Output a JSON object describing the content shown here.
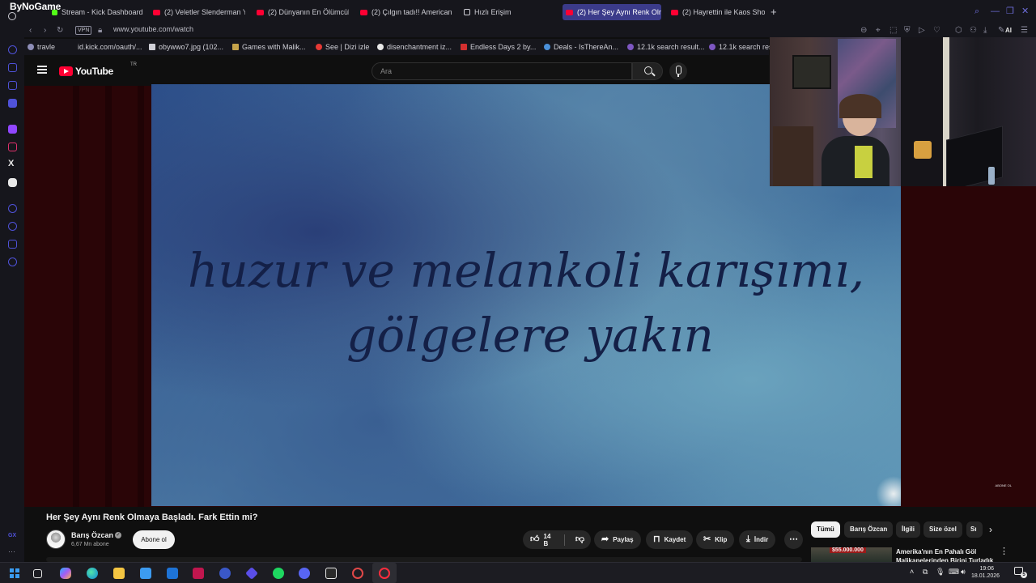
{
  "browser": {
    "brand": "ByNoGame",
    "tabs": [
      {
        "label": "Stream - Kick Dashboard",
        "icon": "kick-icon",
        "active": false
      },
      {
        "label": "(2) Veletler Slenderman Y",
        "icon": "youtube-icon",
        "active": false
      },
      {
        "label": "(2) Dünyanın En Ölümcül K",
        "icon": "youtube-icon",
        "active": false
      },
      {
        "label": "(2) Çılgın tadı!! American S",
        "icon": "youtube-icon",
        "active": false
      },
      {
        "label": "Hızlı Erişim",
        "icon": "grid-icon",
        "active": false
      },
      {
        "label": "(2) Her Şey Aynı Renk Olm",
        "icon": "youtube-icon",
        "active": true
      },
      {
        "label": "(2) Hayrettin ile Kaos Show",
        "icon": "youtube-icon",
        "active": false
      }
    ],
    "new_tab": "+",
    "vpn_label": "VPN",
    "url": "www.youtube.com/watch",
    "ai_label": "AI",
    "bookmarks": [
      {
        "label": "travle"
      },
      {
        "label": "id.kick.com/oauth/..."
      },
      {
        "label": "obywwo7.jpg (102..."
      },
      {
        "label": "Games with Malik..."
      },
      {
        "label": "See | Dizi izle"
      },
      {
        "label": "disenchantment iz..."
      },
      {
        "label": "Endless Days 2 by..."
      },
      {
        "label": "Deals - IsThereAn..."
      },
      {
        "label": "12.1k search result..."
      },
      {
        "label": "12.1k search res"
      }
    ],
    "sidebar_bottom": "GX",
    "accent_color": "#4f52d9"
  },
  "youtube": {
    "logo_text": "YouTube",
    "country_code": "TR",
    "search_placeholder": "Ara",
    "video": {
      "overlay_lines": [
        "huzur ve melankoli karışımı,",
        "gölgelere yakın"
      ],
      "watermark": "ABONE OL",
      "title": "Her Şey Aynı Renk Olmaya Başladı. Fark Ettin mi?"
    },
    "channel": {
      "name": "Barış Özcan",
      "subscribers": "6,67 Mn abone",
      "subscribe_label": "Abone ol"
    },
    "actions": {
      "likes": "14 B",
      "share": "Paylaş",
      "save": "Kaydet",
      "clip": "Klip",
      "download": "İndir"
    },
    "chips": [
      "Tümü",
      "Barış Özcan",
      "İlgili",
      "Size özel",
      "Sı"
    ],
    "recommended": {
      "price_badge": "$55.000.000",
      "title": "Amerika'nın En Pahalı Göl Malikanelerinden Birini Turladık"
    }
  },
  "taskbar": {
    "time": "19:06",
    "date": "18.01.2026",
    "notification_count": "5",
    "apps": [
      "start-icon",
      "task-view-icon",
      "copilot-icon",
      "edge-icon",
      "file-explorer-icon",
      "store-icon",
      "mail-icon",
      "app-icon",
      "app-icon",
      "app-icon",
      "spotify-icon",
      "discord-icon",
      "epic-games-icon",
      "app-icon",
      "opera-gx-icon"
    ]
  }
}
